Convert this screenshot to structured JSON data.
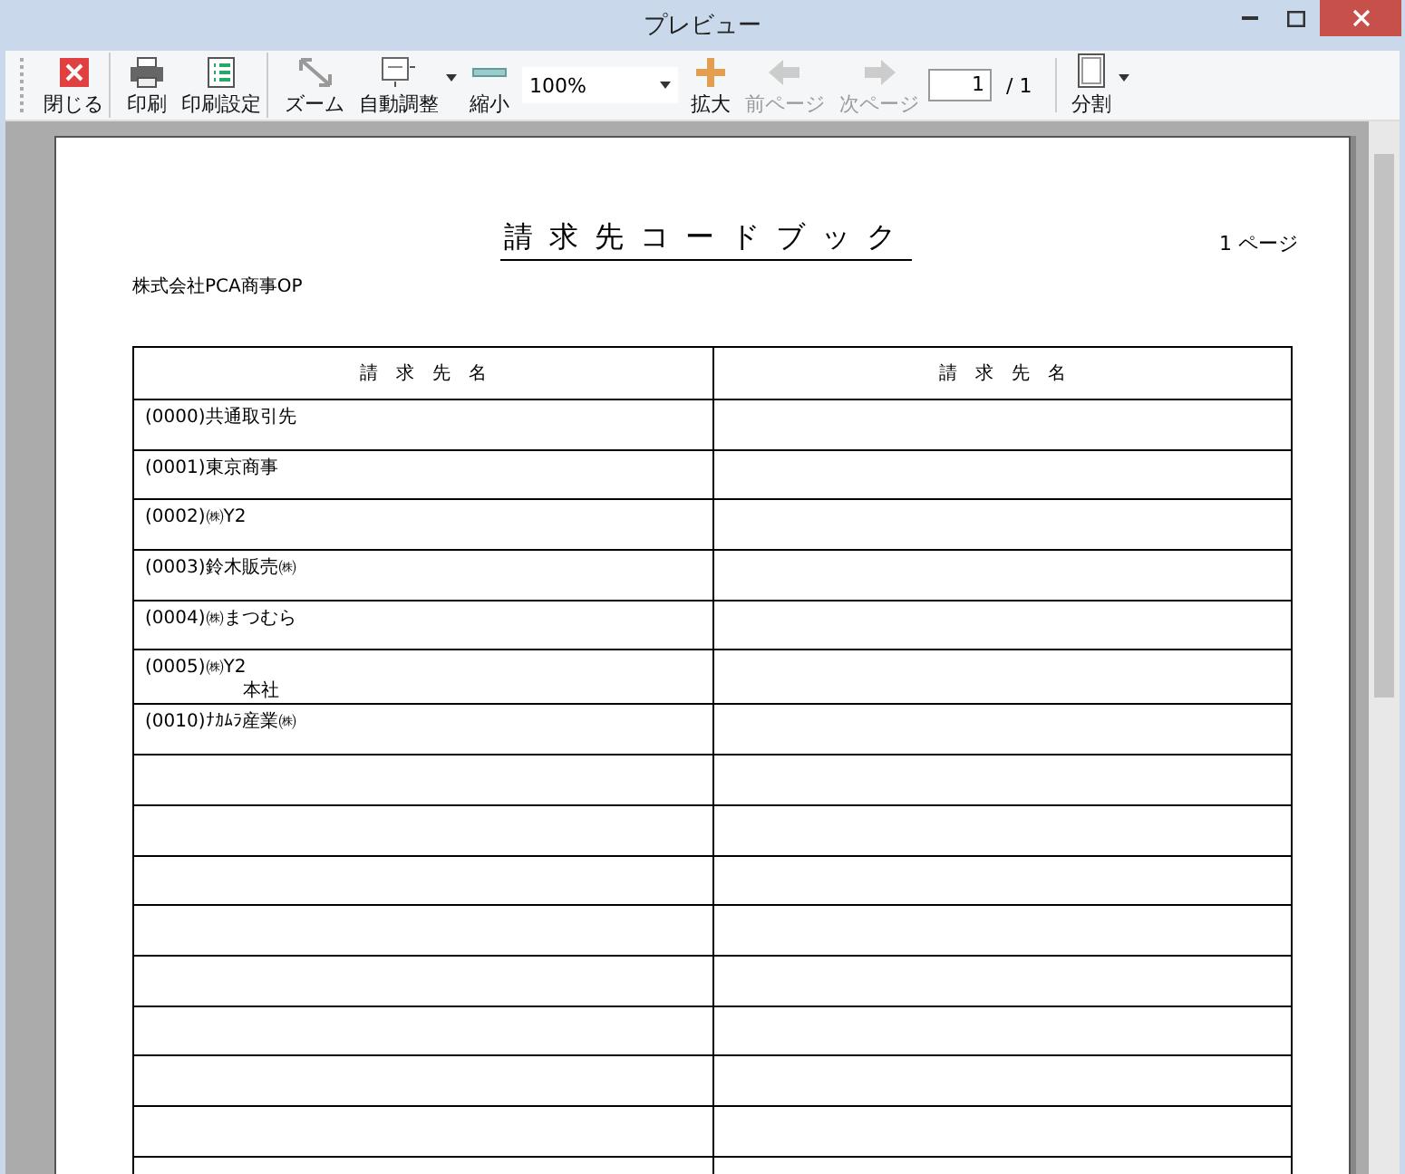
{
  "window": {
    "title": "プレビュー"
  },
  "toolbar": [
    {
      "kind": "button",
      "label": "閉じる",
      "disabled": false,
      "dropdown": false,
      "separator_after": true
    },
    {
      "kind": "button",
      "label": "印刷",
      "disabled": false,
      "dropdown": false,
      "separator_after": false
    },
    {
      "kind": "button",
      "label": "印刷設定",
      "disabled": false,
      "dropdown": false,
      "separator_after": true
    },
    {
      "kind": "button",
      "label": "ズーム",
      "disabled": false,
      "dropdown": false,
      "separator_after": false
    },
    {
      "kind": "button",
      "label": "自動調整",
      "disabled": false,
      "dropdown": true,
      "separator_after": false
    },
    {
      "kind": "button",
      "label": "縮小",
      "disabled": false,
      "dropdown": false,
      "separator_after": false
    },
    {
      "kind": "combo",
      "value": "100%"
    },
    {
      "kind": "button",
      "label": "拡大",
      "disabled": false,
      "dropdown": false,
      "separator_after": false
    },
    {
      "kind": "button",
      "label": "前ページ",
      "disabled": true,
      "dropdown": false,
      "separator_after": false
    },
    {
      "kind": "button",
      "label": "次ページ",
      "disabled": true,
      "dropdown": false,
      "separator_after": false
    },
    {
      "kind": "page",
      "value": "1",
      "total": "/ 1"
    },
    {
      "kind": "button",
      "label": "分割",
      "disabled": false,
      "dropdown": true,
      "separator_after": false
    }
  ],
  "document": {
    "title": "請求先コードブック",
    "page_label": "1 ページ",
    "company": "株式会社PCA商事OP",
    "columns": [
      "請　求　先　名",
      "請　求　先　名"
    ],
    "rows": [
      {
        "lines": [
          "(0000)共通取引先"
        ]
      },
      {
        "lines": [
          "(0001)東京商事"
        ]
      },
      {
        "lines": [
          "(0002)㈱Y2"
        ]
      },
      {
        "lines": [
          "(0003)鈴木販売㈱"
        ]
      },
      {
        "lines": [
          "(0004)㈱まつむら"
        ]
      },
      {
        "lines": [
          "(0005)㈱Y2",
          "本社"
        ]
      },
      {
        "lines": [
          "(0010)ﾅｶﾑﾗ産業㈱"
        ]
      }
    ]
  }
}
